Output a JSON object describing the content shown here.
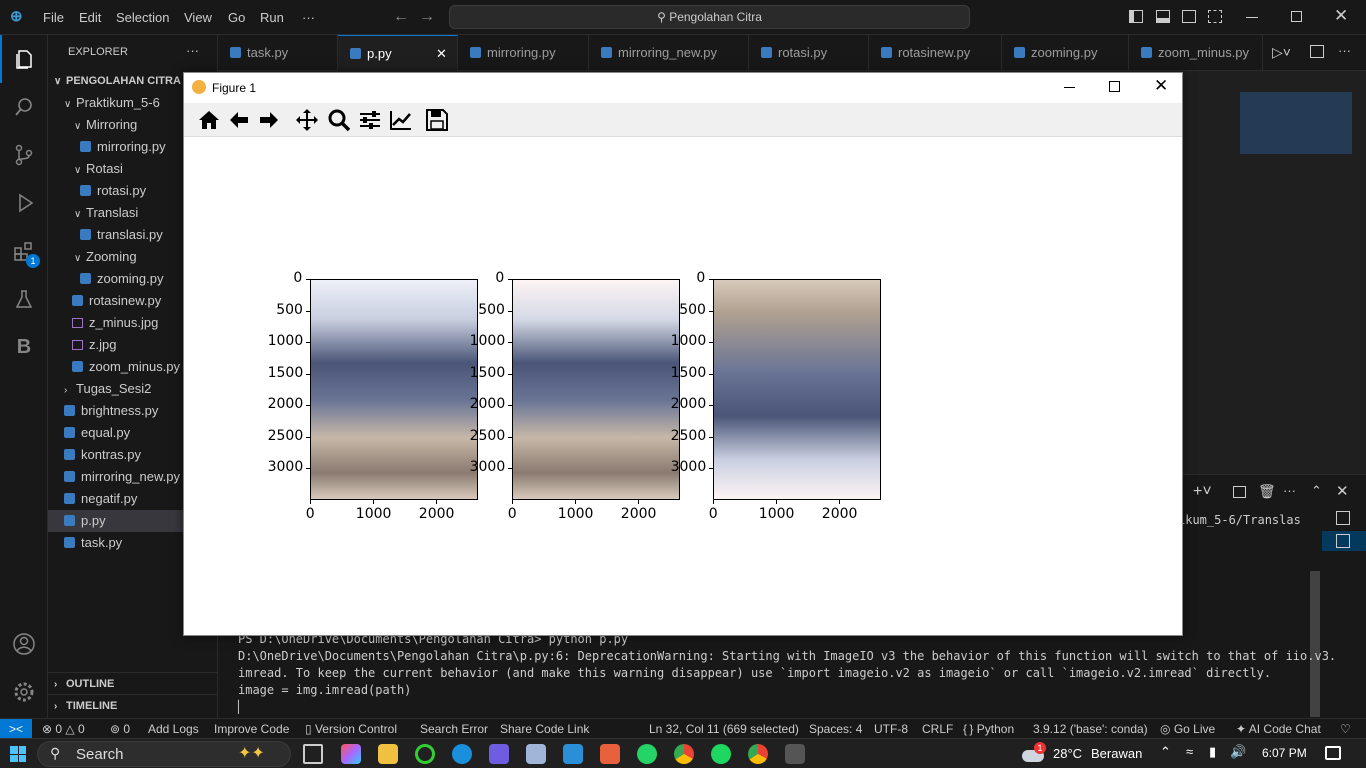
{
  "menu": {
    "file": "File",
    "edit": "Edit",
    "selection": "Selection",
    "view": "View",
    "go": "Go",
    "run": "Run",
    "more": "···"
  },
  "search": {
    "label": "Pengolahan Citra"
  },
  "explorer": {
    "title": "EXPLORER",
    "root": "PENGOLAHAN CITRA",
    "items": [
      {
        "label": "Praktikum_5-6"
      },
      {
        "label": "Mirroring"
      },
      {
        "label": "mirroring.py"
      },
      {
        "label": "Rotasi"
      },
      {
        "label": "rotasi.py"
      },
      {
        "label": "Translasi"
      },
      {
        "label": "translasi.py"
      },
      {
        "label": "Zooming"
      },
      {
        "label": "zooming.py"
      },
      {
        "label": "rotasinew.py"
      },
      {
        "label": "z_minus.jpg"
      },
      {
        "label": "z.jpg"
      },
      {
        "label": "zoom_minus.py"
      },
      {
        "label": "Tugas_Sesi2"
      },
      {
        "label": "brightness.py"
      },
      {
        "label": "equal.py"
      },
      {
        "label": "kontras.py"
      },
      {
        "label": "mirroring_new.py"
      },
      {
        "label": "negatif.py"
      },
      {
        "label": "p.py"
      },
      {
        "label": "task.py"
      }
    ],
    "outline": "OUTLINE",
    "timeline": "TIMELINE"
  },
  "tabs": [
    {
      "label": "task.py"
    },
    {
      "label": "p.py"
    },
    {
      "label": "mirroring.py"
    },
    {
      "label": "mirroring_new.py"
    },
    {
      "label": "rotasi.py"
    },
    {
      "label": "rotasinew.py"
    },
    {
      "label": "zooming.py"
    },
    {
      "label": "zoom_minus.py"
    }
  ],
  "badge": "1",
  "terminal": {
    "line1": "PS D:\\OneDrive\\Documents\\Pengolahan Citra> python p.py",
    "line2": "D:\\OneDrive\\Documents\\Pengolahan Citra\\p.py:6: DeprecationWarning: Starting with ImageIO v3 the behavior of this function will switch to that of iio.v3.",
    "line3": "imread. To keep the current behavior (and make this warning disappear) use `import imageio.v2 as imageio` or call `imageio.v2.imread` directly.",
    "line4": "  image = img.imread(path)",
    "cursor": "▏",
    "right_path": "ikum_5-6/Translas"
  },
  "status": {
    "problems": "0",
    "warnings": "0",
    "ports": "0",
    "add_logs": "Add Logs",
    "improve": "Improve Code",
    "version": "Version Control",
    "search_error": "Search Error",
    "share": "Share Code Link",
    "position": "Ln 32, Col 11 (669 selected)",
    "spaces": "Spaces: 4",
    "encoding": "UTF-8",
    "eol": "CRLF",
    "language": "Python",
    "interpreter": "3.9.12 ('base': conda)",
    "golive": "Go Live",
    "aichat": "AI Code Chat"
  },
  "taskbar": {
    "search": "Search",
    "temp": "28°C",
    "weather": "Berawan",
    "time": "6:07 PM",
    "weather_badge": "1"
  },
  "figure": {
    "title": "Figure 1"
  },
  "chart_data": [
    {
      "type": "image",
      "title": "",
      "xticks": [
        "0",
        "1000",
        "2000"
      ],
      "yticks": [
        "0",
        "500",
        "1000",
        "1500",
        "2000",
        "2500",
        "3000"
      ],
      "xlim": [
        0,
        2667
      ],
      "ylim": [
        3500,
        0
      ]
    },
    {
      "type": "image",
      "title": "",
      "xticks": [
        "0",
        "1000",
        "2000"
      ],
      "yticks": [
        "0",
        "500",
        "1000",
        "1500",
        "2000",
        "2500",
        "3000"
      ],
      "xlim": [
        0,
        2667
      ],
      "ylim": [
        3500,
        0
      ]
    },
    {
      "type": "image",
      "title": "",
      "xticks": [
        "0",
        "1000",
        "2000"
      ],
      "yticks": [
        "0",
        "500",
        "1000",
        "1500",
        "2000",
        "2500",
        "3000"
      ],
      "xlim": [
        0,
        2667
      ],
      "ylim": [
        3500,
        0
      ]
    }
  ],
  "colors": {
    "accent": "#0078d4",
    "sidebar": "#181818",
    "editor": "#1f1f1f"
  }
}
